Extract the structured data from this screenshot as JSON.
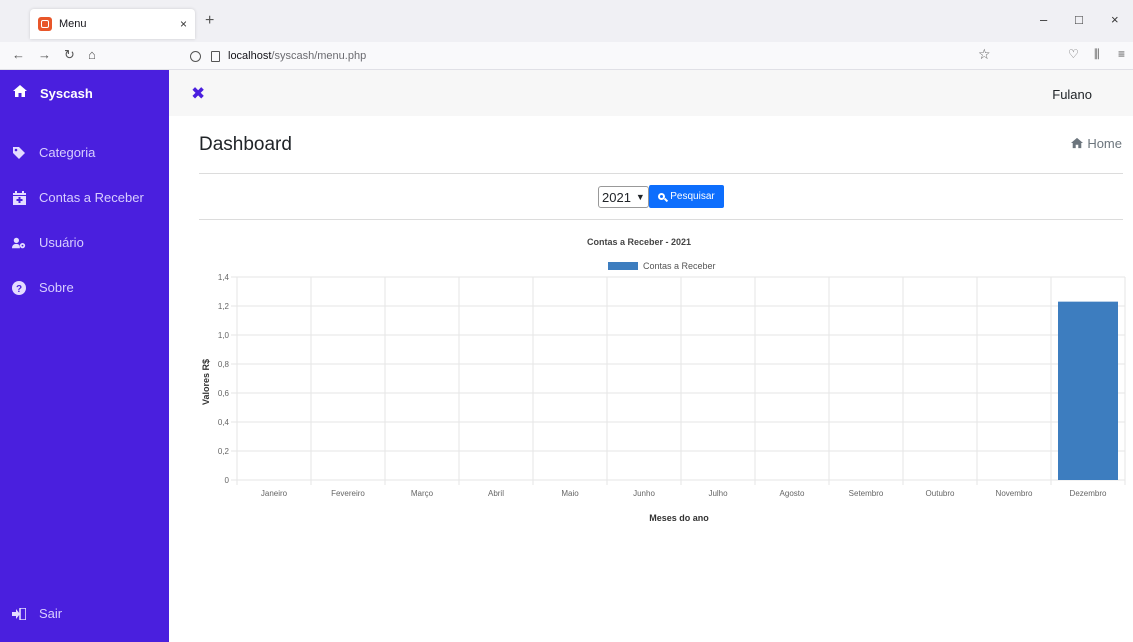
{
  "browser": {
    "tab_title": "Menu",
    "tab_close": "×",
    "new_tab": "+",
    "url_host": "localhost",
    "url_path": "/syscash/menu.php",
    "minimize": "–",
    "maximize": "□",
    "close": "×"
  },
  "sidebar": {
    "brand": "Syscash",
    "items": [
      {
        "label": "Categoria",
        "icon": "tag-icon"
      },
      {
        "label": "Contas a Receber",
        "icon": "calendar-plus-icon"
      },
      {
        "label": "Usuário",
        "icon": "users-cog-icon"
      },
      {
        "label": "Sobre",
        "icon": "question-circle-icon"
      }
    ],
    "logout": "Sair",
    "color": "#4a1fde"
  },
  "header": {
    "user": "Fulano"
  },
  "page": {
    "title": "Dashboard",
    "breadcrumb": "Home",
    "year_selected": "2021",
    "search_button": "Pesquisar"
  },
  "chart_data": {
    "type": "bar",
    "title": "Contas a Receber - 2021",
    "legend": [
      "Contas a Receber"
    ],
    "xlabel": "Meses do ano",
    "ylabel": "Valores R$",
    "categories": [
      "Janeiro",
      "Fevereiro",
      "Março",
      "Abril",
      "Maio",
      "Junho",
      "Julho",
      "Agosto",
      "Setembro",
      "Outubro",
      "Novembro",
      "Dezembro"
    ],
    "series": [
      {
        "name": "Contas a Receber",
        "values": [
          0,
          0,
          0,
          0,
          0,
          0,
          0,
          0,
          0,
          0,
          0,
          1.23
        ]
      }
    ],
    "ylim": [
      0,
      1.4
    ],
    "yticks": [
      "0",
      "0,2",
      "0,4",
      "0,6",
      "0,8",
      "1,0",
      "1,2",
      "1,4"
    ],
    "color": "#3d7dbf",
    "grid": true,
    "legend_position": "top"
  }
}
